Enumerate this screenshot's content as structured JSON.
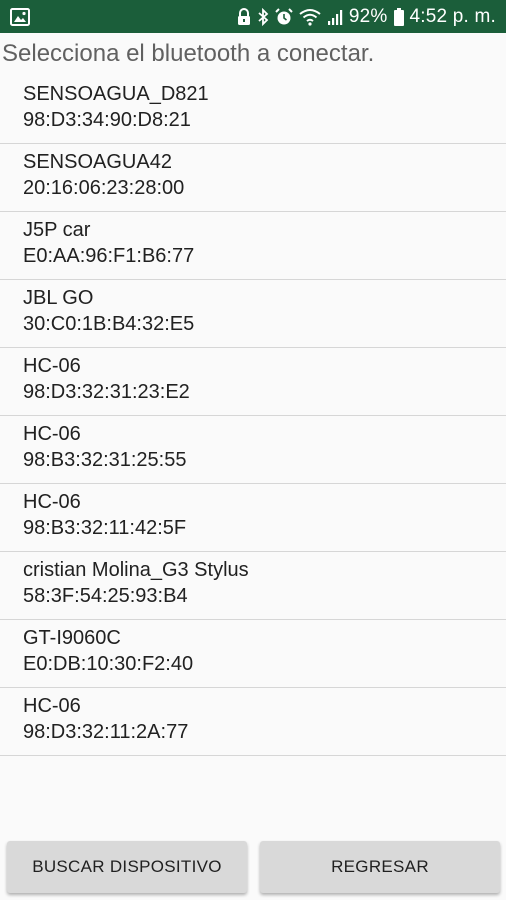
{
  "status_bar": {
    "left_icon": "image-icon",
    "icons": [
      "lock-icon",
      "bluetooth-icon",
      "alarm-icon",
      "wifi-icon",
      "signal-icon",
      "battery-icon"
    ],
    "battery": "92%",
    "time": "4:52 p. m.",
    "background_color": "#1b5e3a"
  },
  "prompt": "Selecciona el bluetooth a conectar.",
  "devices": [
    {
      "name": "SENSOAGUA_D821",
      "address": "98:D3:34:90:D8:21"
    },
    {
      "name": "SENSOAGUA42",
      "address": "20:16:06:23:28:00"
    },
    {
      "name": "J5P car",
      "address": "E0:AA:96:F1:B6:77"
    },
    {
      "name": "JBL GO",
      "address": "30:C0:1B:B4:32:E5"
    },
    {
      "name": "HC-06",
      "address": "98:D3:32:31:23:E2"
    },
    {
      "name": "HC-06",
      "address": "98:B3:32:31:25:55"
    },
    {
      "name": "HC-06",
      "address": "98:B3:32:11:42:5F"
    },
    {
      "name": "cristian Molina_G3 Stylus",
      "address": "58:3F:54:25:93:B4"
    },
    {
      "name": "GT-I9060C",
      "address": "E0:DB:10:30:F2:40"
    },
    {
      "name": "HC-06",
      "address": "98:D3:32:11:2A:77"
    }
  ],
  "buttons": {
    "search": "BUSCAR DISPOSITIVO",
    "back": "REGRESAR"
  }
}
